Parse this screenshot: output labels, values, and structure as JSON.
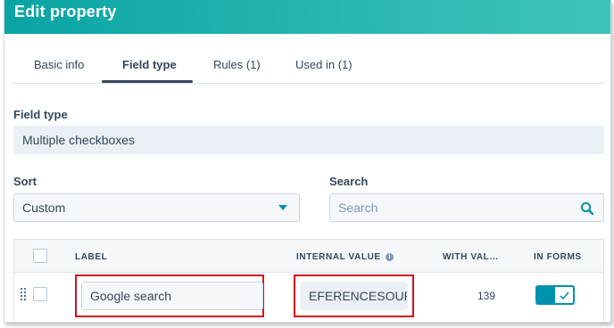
{
  "header": {
    "title": "Edit property"
  },
  "tabs": [
    {
      "label": "Basic info"
    },
    {
      "label": "Field type"
    },
    {
      "label": "Rules (1)"
    },
    {
      "label": "Used in (1)"
    }
  ],
  "active_tab": "Field type",
  "field_type": {
    "label": "Field type",
    "value": "Multiple checkboxes"
  },
  "sort": {
    "label": "Sort",
    "value": "Custom"
  },
  "search": {
    "label": "Search",
    "placeholder": "Search"
  },
  "table": {
    "columns": {
      "label": "LABEL",
      "internal_value": "INTERNAL VALUE",
      "with_values": "WITH VAL…",
      "in_forms": "IN FORMS"
    },
    "rows": [
      {
        "label": "Google search",
        "internal_value": "EFERENCESOUR",
        "with_values": "139",
        "in_forms": true
      }
    ]
  },
  "colors": {
    "header": "#0aa4a4",
    "accent": "#0091ae",
    "highlight": "#d0121b"
  },
  "icons": [
    "search-icon",
    "info-icon",
    "drag-handle-icon",
    "check-icon",
    "chevron-down-icon"
  ]
}
